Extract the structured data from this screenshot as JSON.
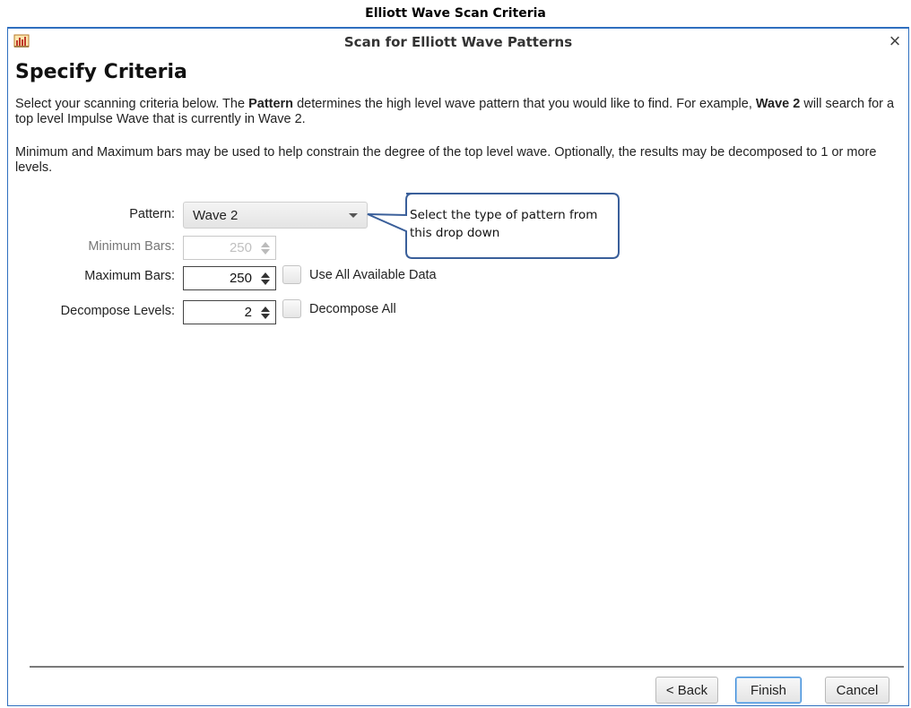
{
  "caption": "Elliott Wave Scan Criteria",
  "dialog": {
    "title": "Scan for Elliott Wave Patterns",
    "close_glyph": "×",
    "icon": "app-icon"
  },
  "heading": "Specify Criteria",
  "paragraph1": {
    "pre": "Select your scanning criteria below.  The ",
    "bold1": "Pattern",
    "mid": " determines the high level wave pattern that you would like to find.  For example, ",
    "bold2": "Wave 2",
    "post": " will search for a top level Impulse Wave that is currently in Wave 2."
  },
  "paragraph2": "Minimum and Maximum bars may be used to help constrain the degree of the top level wave.  Optionally, the results may be decomposed to 1 or more levels.",
  "form": {
    "pattern_label": "Pattern:",
    "pattern_value": "Wave 2",
    "min_bars_label": "Minimum Bars:",
    "min_bars_value": "250",
    "max_bars_label": "Maximum Bars:",
    "max_bars_value": "250",
    "use_all_label": "Use All Available Data",
    "use_all_checked": false,
    "decompose_label": "Decompose Levels:",
    "decompose_value": "2",
    "decompose_all_label": "Decompose All",
    "decompose_all_checked": false
  },
  "callout": {
    "text": "Select the type of pattern from this drop down"
  },
  "buttons": {
    "back": "< Back",
    "finish": "Finish",
    "cancel": "Cancel"
  },
  "colors": {
    "dialog_border": "#2f6fbf",
    "callout_border": "#3a5f9a",
    "default_button_border": "#3c8ad6"
  }
}
